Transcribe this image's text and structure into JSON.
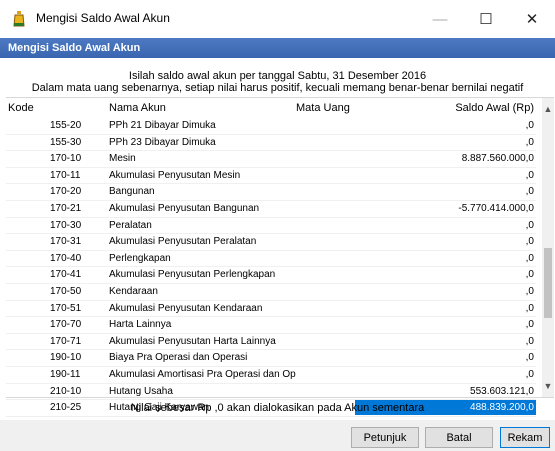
{
  "window": {
    "title": "Mengisi Saldo Awal Akun",
    "minimize_glyph": "—",
    "maximize_glyph": "☐",
    "close_glyph": "✕"
  },
  "header": {
    "title": "Mengisi Saldo Awal Akun"
  },
  "info": {
    "line1": "Isilah saldo awal akun per tanggal Sabtu, 31 Desember 2016",
    "line2": "Dalam mata uang sebenarnya, setiap nilai harus positif, kecuali memang benar-benar bernilai negatif"
  },
  "grid": {
    "columns": {
      "kode": "Kode",
      "nama": "Nama Akun",
      "mata": "Mata Uang",
      "saldo": "Saldo Awal (Rp)"
    },
    "rows": [
      {
        "kode": "155-20",
        "nama": "PPh 21 Dibayar Dimuka",
        "mata": "",
        "saldo": ",0"
      },
      {
        "kode": "155-30",
        "nama": "PPh 23 Dibayar Dimuka",
        "mata": "",
        "saldo": ",0"
      },
      {
        "kode": "170-10",
        "nama": "Mesin",
        "mata": "",
        "saldo": "8.887.560.000,0"
      },
      {
        "kode": "170-11",
        "nama": "Akumulasi Penyusutan Mesin",
        "mata": "",
        "saldo": ",0"
      },
      {
        "kode": "170-20",
        "nama": "Bangunan",
        "mata": "",
        "saldo": ",0"
      },
      {
        "kode": "170-21",
        "nama": "Akumulasi Penyusutan Bangunan",
        "mata": "",
        "saldo": "-5.770.414.000,0"
      },
      {
        "kode": "170-30",
        "nama": "Peralatan",
        "mata": "",
        "saldo": ",0"
      },
      {
        "kode": "170-31",
        "nama": "Akumulasi Penyusutan Peralatan",
        "mata": "",
        "saldo": ",0"
      },
      {
        "kode": "170-40",
        "nama": "Perlengkapan",
        "mata": "",
        "saldo": ",0"
      },
      {
        "kode": "170-41",
        "nama": "Akumulasi Penyusutan Perlengkapan",
        "mata": "",
        "saldo": ",0"
      },
      {
        "kode": "170-50",
        "nama": "Kendaraan",
        "mata": "",
        "saldo": ",0"
      },
      {
        "kode": "170-51",
        "nama": "Akumulasi Penyusutan Kendaraan",
        "mata": "",
        "saldo": ",0"
      },
      {
        "kode": "170-70",
        "nama": "Harta Lainnya",
        "mata": "",
        "saldo": ",0"
      },
      {
        "kode": "170-71",
        "nama": "Akumulasi Penyusutan Harta Lainnya",
        "mata": "",
        "saldo": ",0"
      },
      {
        "kode": "190-10",
        "nama": "Biaya Pra Operasi dan Operasi",
        "mata": "",
        "saldo": ",0"
      },
      {
        "kode": "190-11",
        "nama": "Akumulasi Amortisasi Pra Operasi dan Op",
        "mata": "",
        "saldo": ",0"
      },
      {
        "kode": "210-10",
        "nama": "Hutang Usaha",
        "mata": "",
        "saldo": "553.603.121,0"
      },
      {
        "kode": "210-25",
        "nama": "Hutang Gaji Karyawan",
        "mata": "",
        "saldo": "488.839.200,0",
        "selected": true
      }
    ],
    "scroll_up": "▲",
    "scroll_down": "▼"
  },
  "footer": {
    "note": "Nilai sebesar Rp ,0 akan dialokasikan pada Akun sementara"
  },
  "buttons": {
    "petunjuk": "Petunjuk",
    "batal": "Batal",
    "rekam": "Rekam"
  },
  "colors": {
    "header_bar": "#3a66b1",
    "selection": "#0078d7"
  }
}
